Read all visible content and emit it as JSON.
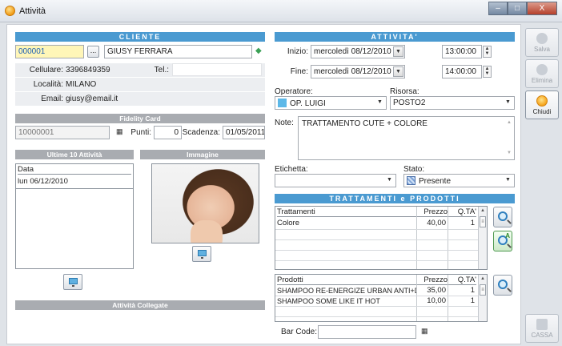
{
  "window": {
    "title": "Attività",
    "minimize": "‒",
    "maximize": "□",
    "close": "X"
  },
  "cliente": {
    "header": "CLIENTE",
    "code": "000001",
    "browse": "...",
    "name": "GIUSY FERRARA",
    "cellulare_label": "Cellulare:",
    "cellulare": "3396849359",
    "tel_label": "Tel.:",
    "tel": "",
    "localita_label": "Località:",
    "localita": "MILANO",
    "email_label": "Email:",
    "email": "giusy@email.it"
  },
  "fidelity": {
    "header": "Fidelity Card",
    "card": "10000001",
    "punti_label": "Punti:",
    "punti": "0",
    "scadenza_label": "Scadenza:",
    "scadenza": "01/05/2011"
  },
  "ultime": {
    "header": "Ultime 10 Attività",
    "column": "Data",
    "rows": [
      "lun 06/12/2010"
    ]
  },
  "immagine": {
    "header": "Immagine"
  },
  "collegate": {
    "header": "Attività Collegate"
  },
  "attivita": {
    "header": "ATTIVITA'",
    "inizio_label": "Inizio:",
    "inizio_date": "mercoledì 08/12/2010",
    "inizio_time": "13:00:00",
    "fine_label": "Fine:",
    "fine_date": "mercoledì 08/12/2010",
    "fine_time": "14:00:00",
    "operatore_label": "Operatore:",
    "operatore": "OP. LUIGI",
    "operatore_color": "#5cb8e8",
    "risorsa_label": "Risorsa:",
    "risorsa": "POSTO2",
    "note_label": "Note:",
    "note": "TRATTAMENTO CUTE + COLORE",
    "etichetta_label": "Etichetta:",
    "etichetta": "",
    "stato_label": "Stato:",
    "stato": "Presente",
    "stato_color": "#7fa4d8"
  },
  "trattamenti_prodotti": {
    "header": "TRATTAMENTI e PRODOTTI",
    "trattamenti": {
      "columns": [
        "Trattamenti",
        "Prezzo",
        "Q.TA'"
      ],
      "rows": [
        {
          "name": "Colore",
          "prezzo": "40,00",
          "qta": "1"
        }
      ]
    },
    "prodotti": {
      "columns": [
        "Prodotti",
        "Prezzo",
        "Q.TA'"
      ],
      "rows": [
        {
          "name": "SHAMPOO RE-ENERGIZE URBAN ANTI+DC",
          "prezzo": "35,00",
          "qta": "1"
        },
        {
          "name": "SHAMPOO SOME LIKE IT HOT",
          "prezzo": "10,00",
          "qta": "1"
        }
      ]
    },
    "barcode_label": "Bar Code:",
    "barcode": ""
  },
  "toolbar": {
    "salva": "Salva",
    "elimina": "Elimina",
    "chiudi": "Chiudi",
    "cassa": "CASSA"
  },
  "glyphs": {
    "dropdown": "▼",
    "spin_up": "▲",
    "spin_down": "▼",
    "calendar": "▦",
    "tag": "◆",
    "badge_a": "A"
  }
}
